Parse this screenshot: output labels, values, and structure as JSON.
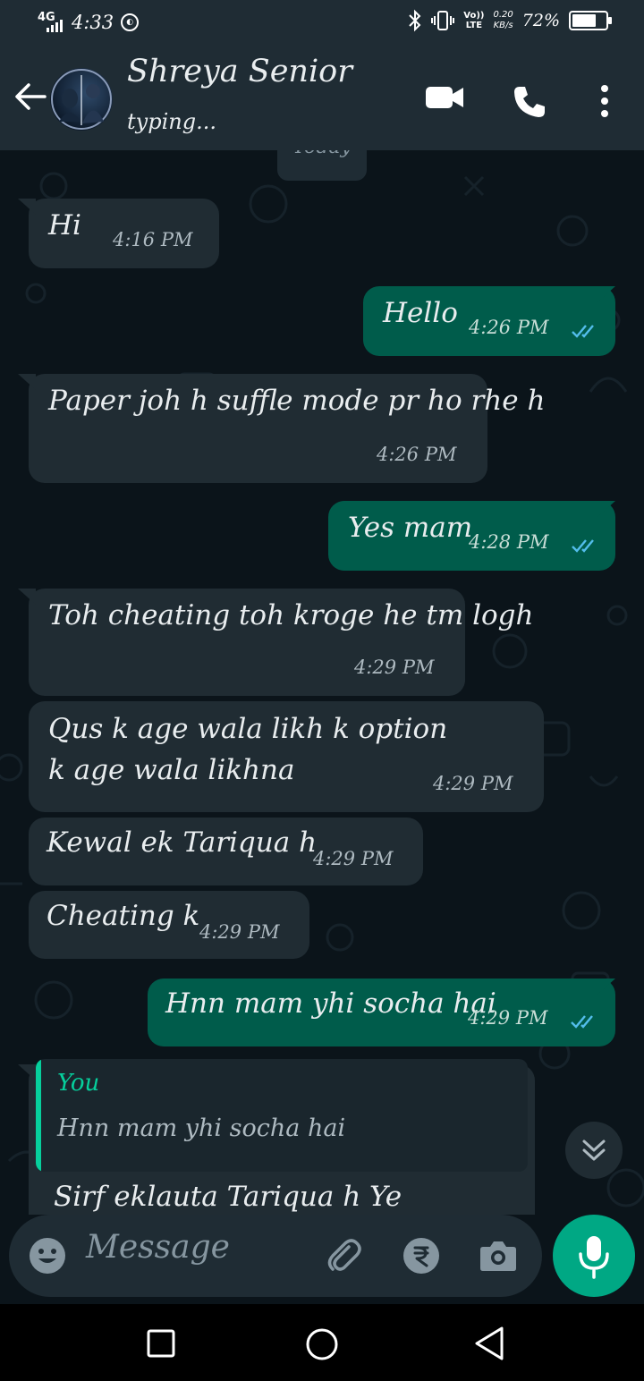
{
  "status_bar": {
    "network": "4G",
    "time": "4:33",
    "volte_top": "Vo))",
    "volte_bottom": "LTE",
    "speed_value": "0.20",
    "speed_unit": "KB/s",
    "battery_percent": "72%",
    "battery_level": 0.72
  },
  "header": {
    "contact_name": "Shreya Senior",
    "contact_status": "typing..."
  },
  "chat": {
    "date_label": "Today",
    "messages": [
      {
        "direction": "incoming",
        "text": "Hi",
        "time": "4:16 PM"
      },
      {
        "direction": "outgoing",
        "text": "Hello",
        "time": "4:26 PM",
        "status": "read"
      },
      {
        "direction": "incoming",
        "text": "Paper joh h suffle mode pr ho rhe h",
        "time": "4:26 PM"
      },
      {
        "direction": "outgoing",
        "text": "Yes mam",
        "time": "4:28 PM",
        "status": "read"
      },
      {
        "direction": "incoming",
        "text": "Toh cheating toh kroge he tm logh",
        "time": "4:29 PM"
      },
      {
        "direction": "incoming",
        "text": "Qus k age wala likh k  option k age wala likhna",
        "time": "4:29 PM"
      },
      {
        "direction": "incoming",
        "text": "Kewal ek Tariqua h",
        "time": "4:29 PM"
      },
      {
        "direction": "incoming",
        "text": "Cheating k",
        "time": "4:29 PM"
      },
      {
        "direction": "outgoing",
        "text": "Hnn mam yhi socha hai",
        "time": "4:29 PM",
        "status": "read"
      }
    ],
    "reply": {
      "quote_author": "You",
      "quote_text": "Hnn mam yhi socha hai",
      "text": "Sirf eklauta Tariqua h   Ye"
    }
  },
  "input": {
    "placeholder": "Message"
  },
  "colors": {
    "background": "#0b141a",
    "header": "#1f2c34",
    "incoming_bubble": "#202c33",
    "outgoing_bubble": "#005c4b",
    "accent": "#00a884",
    "read_ticks": "#53bdeb"
  }
}
